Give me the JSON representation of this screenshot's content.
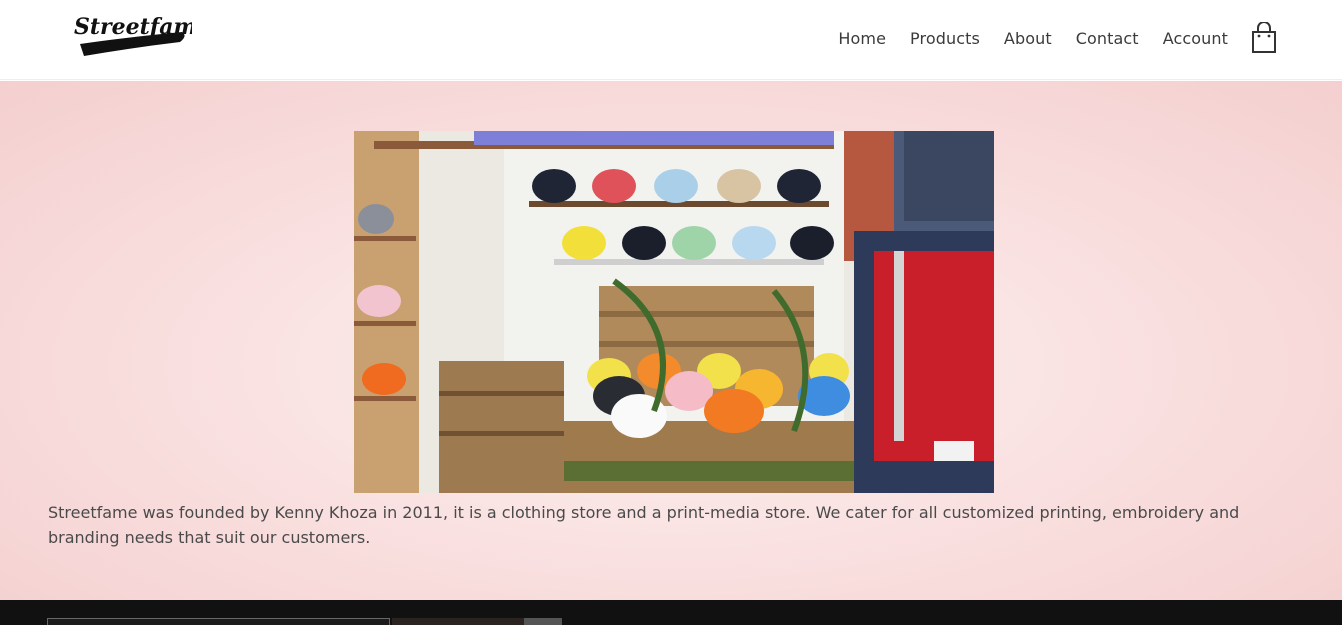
{
  "brand": {
    "logo_text": "Streetfame"
  },
  "nav": {
    "items": [
      {
        "label": "Home"
      },
      {
        "label": "Products"
      },
      {
        "label": "About"
      },
      {
        "label": "Contact"
      },
      {
        "label": "Account"
      }
    ],
    "cart_icon": "shopping-bag-icon"
  },
  "about": {
    "image_alt": "Store interior with bucket hats on shelves and red polo shirt",
    "text": "Streetfame was founded by Kenny Khoza in 2011, it is a clothing store and a print-media store. We cater for all customized printing, embroidery and branding needs that suit our customers."
  },
  "colors": {
    "section_bg": "#f9dede",
    "footer_bg": "#111111",
    "text": "#4a4a4a"
  }
}
